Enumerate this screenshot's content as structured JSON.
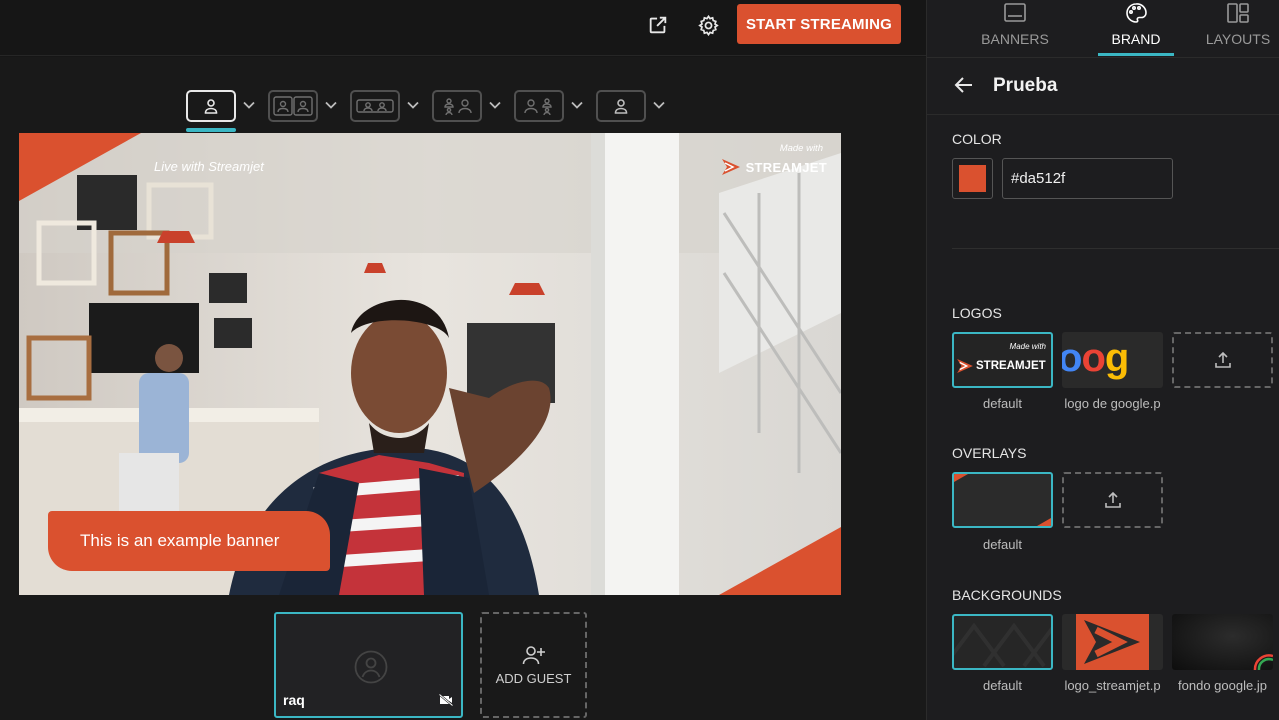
{
  "topbar": {
    "popout_icon": "external-link-icon",
    "settings_icon": "gear-icon",
    "start_label": "START STREAMING",
    "accent": "#da512f"
  },
  "layouts": {
    "options": [
      "single",
      "two-up",
      "side-by-side",
      "grid",
      "grid-alt",
      "solo-small"
    ],
    "active": "single"
  },
  "stage": {
    "live_text": "Live with Streamjet",
    "made_with": "Made with",
    "brand_name": "STREAMJET",
    "banner_text": "This is an example banner"
  },
  "guests": {
    "tile_name": "raq",
    "add_label": "ADD GUEST"
  },
  "panel": {
    "tabs": [
      {
        "label": "BANNERS",
        "icon": "banners-icon"
      },
      {
        "label": "BRAND",
        "icon": "palette-icon"
      },
      {
        "label": "LAYOUTS",
        "icon": "layouts-icon"
      }
    ],
    "active_tab": "BRAND",
    "title": "Prueba",
    "color_label": "COLOR",
    "color_value": "#da512f",
    "logos_label": "LOGOS",
    "logos": [
      {
        "caption": "default",
        "made_with": "Made with",
        "brand": "STREAMJET"
      },
      {
        "caption": "logo de google.p",
        "word": "oog"
      }
    ],
    "overlays_label": "OVERLAYS",
    "overlays": [
      {
        "caption": "default"
      }
    ],
    "backgrounds_label": "BACKGROUNDS",
    "backgrounds": [
      {
        "caption": "default"
      },
      {
        "caption": "logo_streamjet.p"
      },
      {
        "caption": "fondo google.jp"
      }
    ]
  }
}
